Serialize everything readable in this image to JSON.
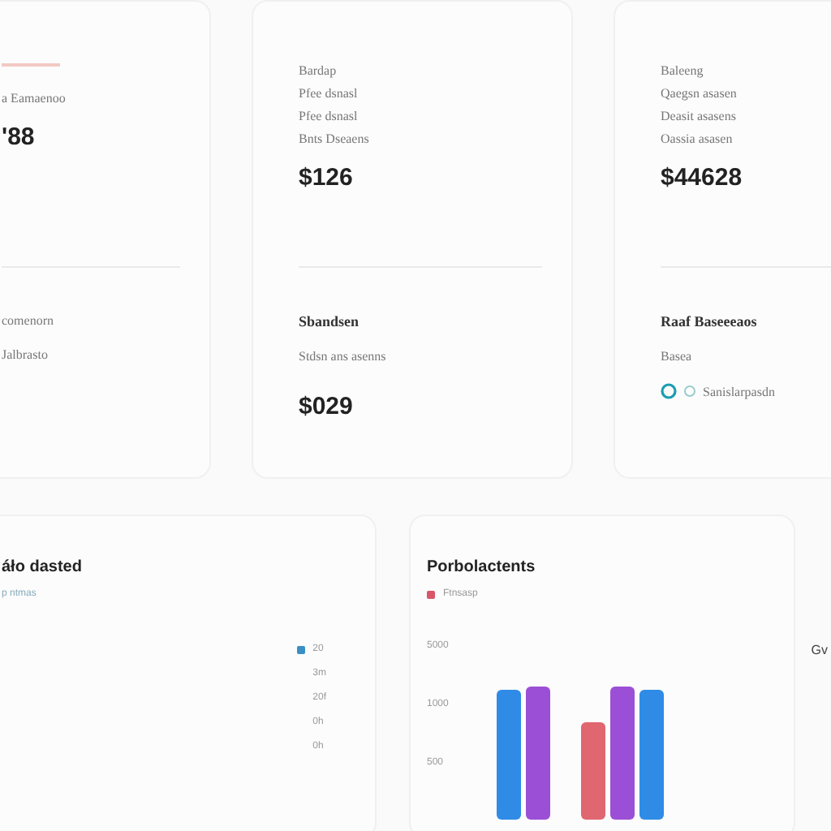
{
  "cards": [
    {
      "top_lines": [
        "a Eamaenoo"
      ],
      "amount": "'88",
      "accent": true,
      "bottom": {
        "lines": [
          "comenorn",
          "Jalbrasto"
        ]
      }
    },
    {
      "top_lines": [
        "Bardap",
        "Pfee dsnasl",
        "Pfee dsnasl",
        "Bnts Dseaens"
      ],
      "amount": "$126",
      "accent": false,
      "bottom": {
        "title": "Sbandsen",
        "lines": [
          "Stdsn ans asenns"
        ],
        "amount": "$029"
      }
    },
    {
      "top_lines": [
        "Baleeng",
        "Qaegsn asasen",
        "Deasit asasens",
        "Oassia asasen"
      ],
      "amount": "$44628",
      "accent": false,
      "bottom": {
        "title": "Raaf Baseeeaos",
        "lines": [
          "Basea"
        ],
        "status": "Sanislarpasdn"
      }
    }
  ],
  "panels": [
    {
      "title": "áło dasted",
      "subtitle": "p ntmas",
      "legend": [
        {
          "label": "20",
          "color": "#3a8fc4"
        },
        {
          "label": "3m"
        },
        {
          "label": "20f"
        },
        {
          "label": "0h"
        },
        {
          "label": "0h"
        }
      ]
    },
    {
      "title": "Porbolactents",
      "legend": [
        {
          "label": "Ftnsasp",
          "color": "#d9566a"
        }
      ],
      "ticks": [
        "5000",
        "1000",
        "500"
      ]
    }
  ],
  "edge_text": "Gv"
}
